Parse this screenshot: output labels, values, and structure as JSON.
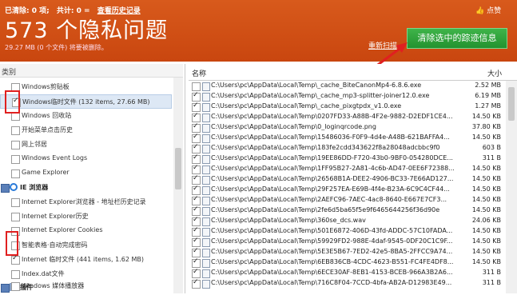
{
  "header": {
    "cleaned_label": "已清除: 0 项;",
    "total_label": "共计: 0 =",
    "history_link": "查看历史记录",
    "count": "573",
    "count_suffix": "个隐私问题",
    "subtitle": "29.27 MB (0 个文件) 将要被删除。",
    "rescan_link": "重新扫描",
    "like_label": "点赞",
    "clear_button": "清除选中的踪迹信息"
  },
  "left_panel": {
    "header": "类别",
    "items": [
      {
        "label": "Windows剪贴板",
        "checked": false
      },
      {
        "label": "Windows临时文件 (132 items, 27.66 MB)",
        "checked": true,
        "selected": true
      },
      {
        "label": "Windows 回收站",
        "checked": false
      },
      {
        "label": "开始菜单点击历史",
        "checked": false
      },
      {
        "label": "网上邻居",
        "checked": false
      },
      {
        "label": "Windows Event Logs",
        "checked": false
      },
      {
        "label": "Game Explorer",
        "checked": false
      },
      {
        "label": "IE 浏览器",
        "category": true
      },
      {
        "label": "Internet Explorer浏览器 - 地址栏历史记录",
        "checked": false
      },
      {
        "label": "Internet Explorer历史",
        "checked": false
      },
      {
        "label": "Internet Explorer Cookies",
        "checked": false
      },
      {
        "label": "智能表格·自动完成密码",
        "checked": false
      },
      {
        "label": "Internet 临时文件 (441 items, 1.62 MB)",
        "checked": true
      },
      {
        "label": "Index.dat文件",
        "checked": false
      },
      {
        "label": "插件",
        "category": true
      },
      {
        "label": "Windows 媒体播放器",
        "checked": false
      }
    ]
  },
  "right_panel": {
    "col_name": "名称",
    "col_size": "大小",
    "rows": [
      {
        "path": "C:\\Users\\pc\\AppData\\Local\\Temp\\_cache_BiteCanonMp4-6.8.6.exe",
        "size": "2.52 MB",
        "checked": false
      },
      {
        "path": "C:\\Users\\pc\\AppData\\Local\\Temp\\_cache_mp3-splitter-joiner12.0.exe",
        "size": "6.19 MB",
        "checked": true
      },
      {
        "path": "C:\\Users\\pc\\AppData\\Local\\Temp\\_cache_pixgtpdx_v1.0.exe",
        "size": "1.27 MB",
        "checked": true
      },
      {
        "path": "C:\\Users\\pc\\AppData\\Local\\Temp\\0207FD33-A88B-4F2e-9882-D2EDF1CE4...",
        "size": "14.50 KB",
        "checked": true
      },
      {
        "path": "C:\\Users\\pc\\AppData\\Local\\Temp\\0_loginqrcode.png",
        "size": "37.80 KB",
        "checked": true
      },
      {
        "path": "C:\\Users\\pc\\AppData\\Local\\Temp\\15486036-F0F9-4d4e-A48B-621BAFFA4...",
        "size": "14.50 KB",
        "checked": true
      },
      {
        "path": "C:\\Users\\pc\\AppData\\Local\\Temp\\183fe2cdd343622f8a28048adcbbc9f0",
        "size": "603 B",
        "checked": true
      },
      {
        "path": "C:\\Users\\pc\\AppData\\Local\\Temp\\19EE86DD-F720-43b0-9BF0-054280DCE...",
        "size": "311 B",
        "checked": true
      },
      {
        "path": "C:\\Users\\pc\\AppData\\Local\\Temp\\1FF95B27-2A81-4c6b-AD47-0EE6F72388...",
        "size": "14.50 KB",
        "checked": true
      },
      {
        "path": "C:\\Users\\pc\\AppData\\Local\\Temp\\26568B1A-DEE2-4906-BC33-7E66AD127...",
        "size": "14.50 KB",
        "checked": true
      },
      {
        "path": "C:\\Users\\pc\\AppData\\Local\\Temp\\29F257EA-E69B-4f4e-B23A-6C9C4CF44...",
        "size": "14.50 KB",
        "checked": true
      },
      {
        "path": "C:\\Users\\pc\\AppData\\Local\\Temp\\2AEFC96-7AEC-4ac8-8640-E667E7CF3...",
        "size": "14.50 KB",
        "checked": true
      },
      {
        "path": "C:\\Users\\pc\\AppData\\Local\\Temp\\2fe6d5ba65f5e9f6465644256f36d90e",
        "size": "14.50 KB",
        "checked": true
      },
      {
        "path": "C:\\Users\\pc\\AppData\\Local\\Temp\\360se_dcs.wav",
        "size": "24.06 KB",
        "checked": true
      },
      {
        "path": "C:\\Users\\pc\\AppData\\Local\\Temp\\501E6872-406D-43fd-ADDC-57C10FADA...",
        "size": "14.50 KB",
        "checked": true
      },
      {
        "path": "C:\\Users\\pc\\AppData\\Local\\Temp\\59929FD2-988E-4daf-9545-0DF20C1C9F...",
        "size": "14.50 KB",
        "checked": true
      },
      {
        "path": "C:\\Users\\pc\\AppData\\Local\\Temp\\5E3E5B67-7ED2-42e5-8BA5-2FFCC9A74...",
        "size": "14.50 KB",
        "checked": true
      },
      {
        "path": "C:\\Users\\pc\\AppData\\Local\\Temp\\6EB836CB-4CDC-4623-B551-FC4FE4DF8...",
        "size": "14.50 KB",
        "checked": true
      },
      {
        "path": "C:\\Users\\pc\\AppData\\Local\\Temp\\6ECE30AF-8EB1-4153-BCEB-966A3B2A6...",
        "size": "311 B",
        "checked": true
      },
      {
        "path": "C:\\Users\\pc\\AppData\\Local\\Temp\\716C8F04-7CCD-4bfa-AB2A-D12983E49...",
        "size": "311 B",
        "checked": true
      }
    ]
  },
  "colors": {
    "header_orange": "#d0511a",
    "clear_button_green": "#2ea23a",
    "highlight_red": "#e02020"
  }
}
